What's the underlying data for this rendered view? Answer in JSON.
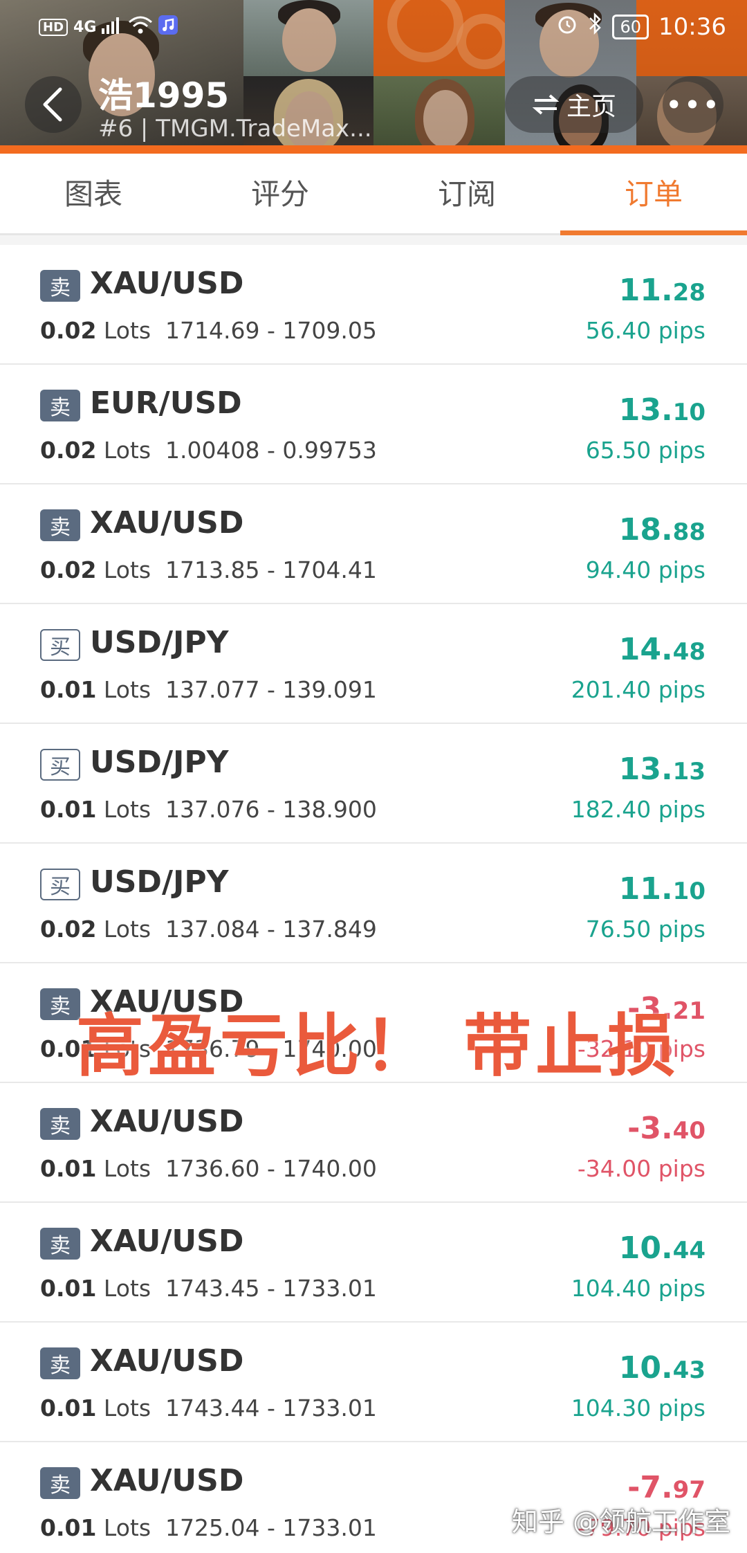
{
  "status_bar": {
    "network": "HD",
    "signal": "4G",
    "time": "10:36",
    "battery": "60"
  },
  "header": {
    "back_icon": "chevron-left-icon",
    "user_name": "浩1995",
    "user_subtitle": "#6 | TMGM.TradeMax...",
    "home_label": "主页",
    "home_icon": "switch-icon",
    "more_label": "•••",
    "accent_color": "#f36b1f"
  },
  "tabs": [
    {
      "label": "图表",
      "active": false
    },
    {
      "label": "评分",
      "active": false
    },
    {
      "label": "订阅",
      "active": false
    },
    {
      "label": "订单",
      "active": true
    }
  ],
  "labels": {
    "sell": "卖",
    "buy": "买",
    "lots_unit": "Lots",
    "pips_unit": "pips"
  },
  "orders": [
    {
      "side": "sell",
      "symbol": "XAU/USD",
      "lots": "0.02",
      "open": "1714.69",
      "close": "1709.05",
      "profit_int": "11.",
      "profit_dec": "28",
      "pips": "56.40"
    },
    {
      "side": "sell",
      "symbol": "EUR/USD",
      "lots": "0.02",
      "open": "1.00408",
      "close": "0.99753",
      "profit_int": "13.",
      "profit_dec": "10",
      "pips": "65.50"
    },
    {
      "side": "sell",
      "symbol": "XAU/USD",
      "lots": "0.02",
      "open": "1713.85",
      "close": "1704.41",
      "profit_int": "18.",
      "profit_dec": "88",
      "pips": "94.40"
    },
    {
      "side": "buy",
      "symbol": "USD/JPY",
      "lots": "0.01",
      "open": "137.077",
      "close": "139.091",
      "profit_int": "14.",
      "profit_dec": "48",
      "pips": "201.40"
    },
    {
      "side": "buy",
      "symbol": "USD/JPY",
      "lots": "0.01",
      "open": "137.076",
      "close": "138.900",
      "profit_int": "13.",
      "profit_dec": "13",
      "pips": "182.40"
    },
    {
      "side": "buy",
      "symbol": "USD/JPY",
      "lots": "0.02",
      "open": "137.084",
      "close": "137.849",
      "profit_int": "11.",
      "profit_dec": "10",
      "pips": "76.50"
    },
    {
      "side": "sell",
      "symbol": "XAU/USD",
      "lots": "0.01",
      "open": "1736.79",
      "close": "1740.00",
      "profit_int": "-3.",
      "profit_dec": "21",
      "pips": "-32.10"
    },
    {
      "side": "sell",
      "symbol": "XAU/USD",
      "lots": "0.01",
      "open": "1736.60",
      "close": "1740.00",
      "profit_int": "-3.",
      "profit_dec": "40",
      "pips": "-34.00"
    },
    {
      "side": "sell",
      "symbol": "XAU/USD",
      "lots": "0.01",
      "open": "1743.45",
      "close": "1733.01",
      "profit_int": "10.",
      "profit_dec": "44",
      "pips": "104.40"
    },
    {
      "side": "sell",
      "symbol": "XAU/USD",
      "lots": "0.01",
      "open": "1743.44",
      "close": "1733.01",
      "profit_int": "10.",
      "profit_dec": "43",
      "pips": "104.30"
    },
    {
      "side": "sell",
      "symbol": "XAU/USD",
      "lots": "0.01",
      "open": "1725.04",
      "close": "1733.01",
      "profit_int": "-7.",
      "profit_dec": "97",
      "pips": "-79.70"
    }
  ],
  "colors": {
    "positive": "#1aa38e",
    "negative": "#e05467",
    "sell_badge": "#5b6b80"
  },
  "overlay": {
    "caption": "高盈亏比！  带止损",
    "watermark": "知乎 @领航工作室"
  }
}
